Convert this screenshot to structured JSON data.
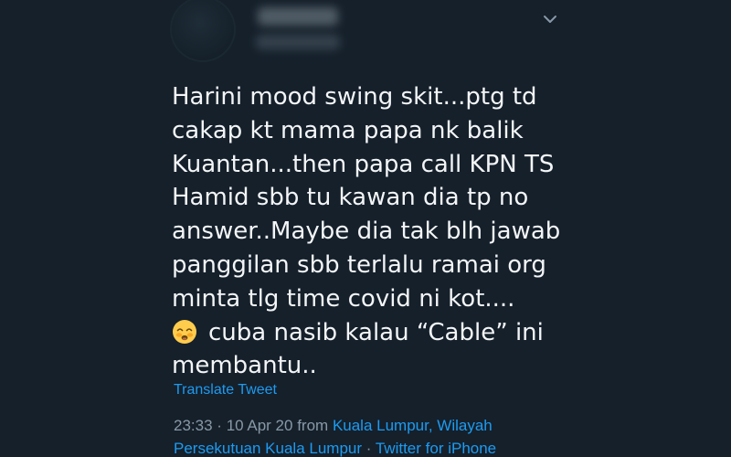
{
  "tweet": {
    "author": {
      "name": "",
      "handle": ""
    },
    "text_lines": [
      "Harini mood swing skit...ptg td",
      "cakap kt mama papa nk balik",
      "Kuantan...then papa call KPN TS",
      "Hamid sbb tu kawan dia tp no",
      "answer..Maybe dia tak blh jawab",
      "panggilan sbb terlalu ramai org",
      "minta tlg time covid ni kot....",
      "cuba nasib kalau “Cable” ini",
      "membantu.."
    ],
    "emoji": "pleading-face-emoji",
    "translate_label": "Translate Tweet",
    "time": "23:33",
    "separator": "·",
    "date": "10 Apr 20",
    "from_label": "from",
    "location_line1": "Kuala Lumpur, Wilayah",
    "location_line2": "Persekutuan Kuala Lumpur",
    "client": "Twitter for iPhone"
  },
  "icons": {
    "more_menu": "chevron-down-icon",
    "avatar": "avatar"
  },
  "colors": {
    "background": "#15202b",
    "text": "#f3f5f7",
    "link": "#1d9bf0",
    "muted": "#8899a6"
  }
}
